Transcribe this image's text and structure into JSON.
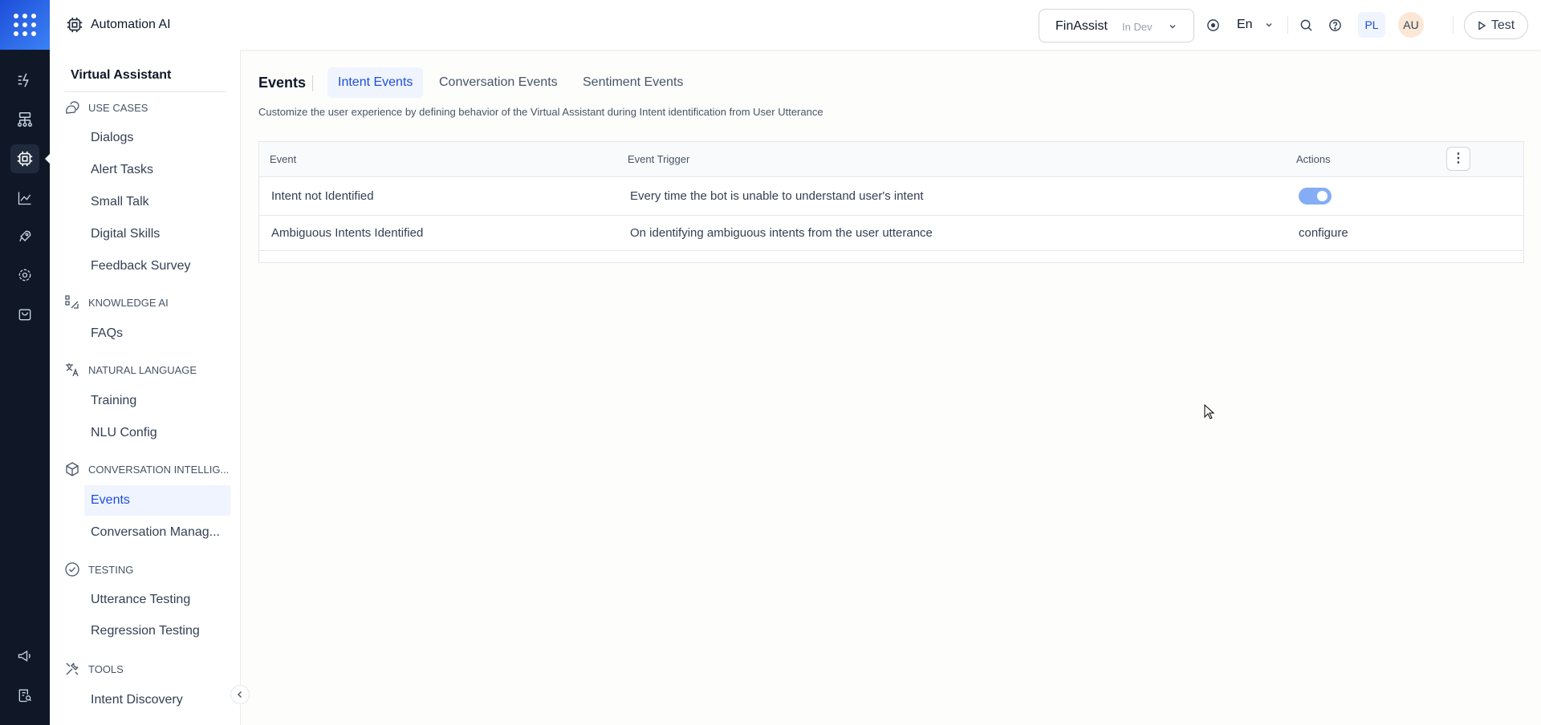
{
  "header": {
    "app_title": "Automation AI",
    "bot_name": "FinAssist",
    "bot_status": "In Dev",
    "language": "En",
    "user_initials_1": "PL",
    "user_initials_2": "AU",
    "test_label": "Test"
  },
  "sidebar": {
    "title": "Virtual Assistant",
    "sections": [
      {
        "label": "USE CASES",
        "icon": "chat-bubbles-icon",
        "items": [
          "Dialogs",
          "Alert Tasks",
          "Small Talk",
          "Digital Skills",
          "Feedback Survey"
        ]
      },
      {
        "label": "KNOWLEDGE AI",
        "icon": "knowledge-icon",
        "items": [
          "FAQs"
        ]
      },
      {
        "label": "NATURAL LANGUAGE",
        "icon": "translate-icon",
        "items": [
          "Training",
          "NLU Config"
        ]
      },
      {
        "label": "CONVERSATION INTELLIG...",
        "icon": "cube-icon",
        "items": [
          "Events",
          "Conversation Manag..."
        ]
      },
      {
        "label": "TESTING",
        "icon": "check-circle-icon",
        "items": [
          "Utterance Testing",
          "Regression Testing"
        ]
      },
      {
        "label": "TOOLS",
        "icon": "tools-icon",
        "items": [
          "Intent Discovery"
        ]
      }
    ],
    "selected": "Events"
  },
  "main": {
    "title": "Events",
    "tabs": [
      "Intent Events",
      "Conversation Events",
      "Sentiment Events"
    ],
    "active_tab": "Intent Events",
    "description": "Customize the user experience by defining behavior of the Virtual Assistant during Intent identification from User Utterance",
    "table": {
      "columns": [
        "Event",
        "Event Trigger",
        "Actions"
      ],
      "rows": [
        {
          "event": "Intent not Identified",
          "trigger": "Every time the bot is unable to understand user's intent",
          "action": "toggle",
          "enabled": true
        },
        {
          "event": "Ambiguous Intents Identified",
          "trigger": "On identifying ambiguous intents from the user utterance",
          "action": "configure"
        }
      ]
    }
  },
  "colors": {
    "accent": "#1d4ed8",
    "rail": "#101828",
    "toggle": "#84adf5"
  }
}
